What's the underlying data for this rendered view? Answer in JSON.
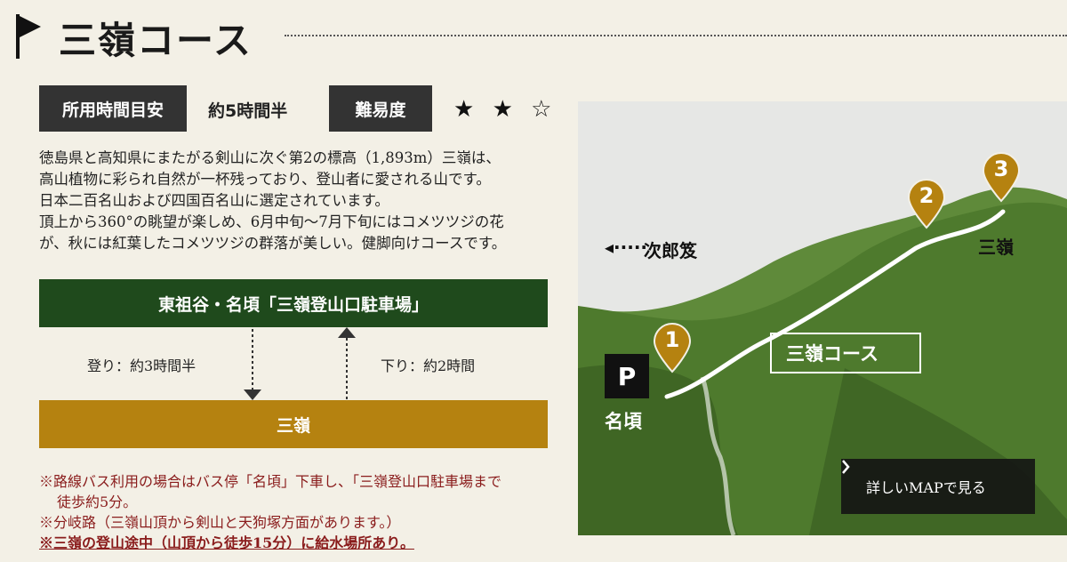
{
  "header": {
    "title": "三嶺コース"
  },
  "info": {
    "time_label": "所用時間目安",
    "time_value": "約5時間半",
    "difficulty_label": "難易度",
    "difficulty_stars_filled": "★ ★",
    "difficulty_stars_empty": "☆",
    "difficulty_rating": 2,
    "difficulty_max": 3
  },
  "description": [
    "徳島県と高知県にまたがる剣山に次ぐ第2の標高（1,893m）三嶺は、",
    "高山植物に彩られ自然が一杯残っており、登山者に愛される山です。",
    "日本二百名山および四国百名山に選定されています。",
    "頂上から360°の眺望が楽しめ、6月中旬〜7月下旬にはコメツツジの花",
    "が、秋には紅葉したコメツツジの群落が美しい。健脚向けコースです。"
  ],
  "route": {
    "start": "東祖谷・名頃「三嶺登山口駐車場」",
    "end": "三嶺",
    "up": "登り：約3時間半",
    "down": "下り：約2時間"
  },
  "notes": {
    "note1_line1": "※路線バス利用の場合はバス停「名頃」下車し、「三嶺登山口駐車場まで",
    "note1_line2": "徒歩約5分。",
    "note2": "※分岐路（三嶺山頂から剣山と天狗塚方面があります。）",
    "note3": "※三嶺の登山途中（山頂から徒歩15分）に給水場所あり。"
  },
  "map": {
    "jiro_arrow": "◂·····",
    "jiro": "次郎笈",
    "peak": "三嶺",
    "trail": "三嶺コース",
    "parking": "P",
    "nagoro": "名頃",
    "markers": [
      "1",
      "2",
      "3"
    ],
    "button": "詳しいMAPで見る"
  },
  "colors": {
    "start_box": "#1f4a1c",
    "end_box": "#b58210",
    "marker": "#b58210",
    "note_text": "#8a1c1c"
  }
}
